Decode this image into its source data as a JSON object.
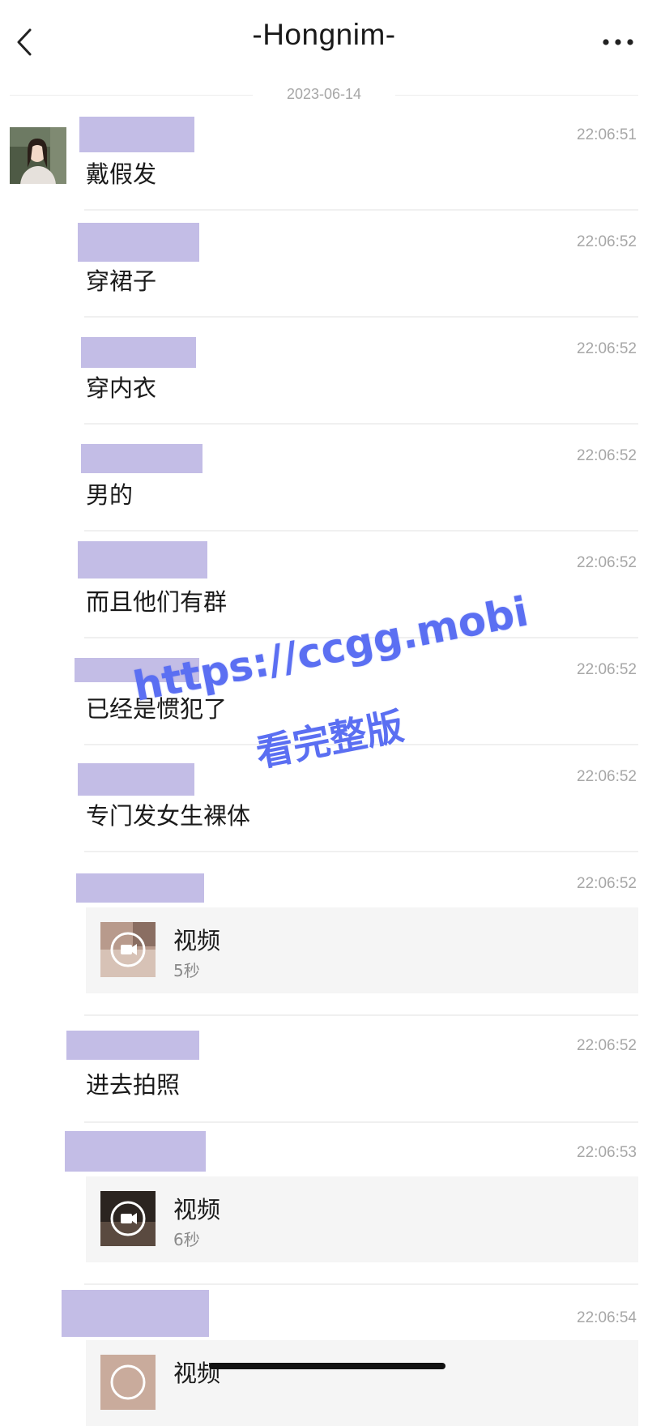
{
  "header": {
    "title": "-Hongnim-",
    "back_icon": "chevron-left-icon",
    "more_icon": "ellipsis-icon"
  },
  "date_divider": "2023-06-14",
  "messages": [
    {
      "time": "22:06:51",
      "text": "戴假发"
    },
    {
      "time": "22:06:52",
      "text": "穿裙子"
    },
    {
      "time": "22:06:52",
      "text": "穿内衣"
    },
    {
      "time": "22:06:52",
      "text": "男的"
    },
    {
      "time": "22:06:52",
      "text": "而且他们有群"
    },
    {
      "time": "22:06:52",
      "text": "已经是惯犯了"
    },
    {
      "time": "22:06:52",
      "text": "专门发女生裸体"
    },
    {
      "time": "22:06:52",
      "video": {
        "title": "视频",
        "duration": "5秒"
      }
    },
    {
      "time": "22:06:52",
      "text": "进去拍照"
    },
    {
      "time": "22:06:53",
      "video": {
        "title": "视频",
        "duration": "6秒"
      }
    },
    {
      "time": "22:06:54",
      "video": {
        "title": "视频"
      }
    }
  ],
  "watermark": {
    "line1": "https://ccgg.mobi",
    "line2": "看完整版"
  },
  "colors": {
    "redaction": "#c3bde6",
    "watermark": "#5b6ff2",
    "timestamp": "#a7a7a7",
    "card_bg": "#f5f5f5"
  }
}
